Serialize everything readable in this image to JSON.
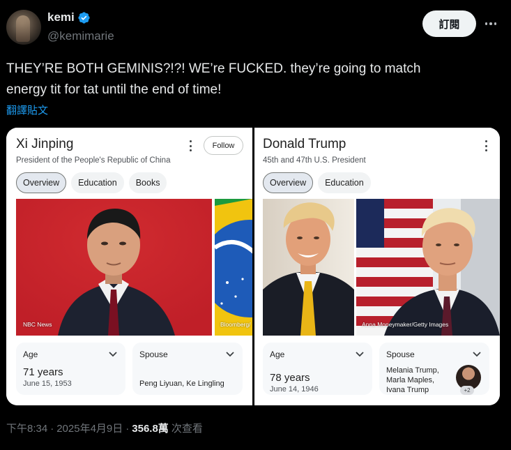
{
  "author": {
    "display_name": "kemi",
    "handle": "@kemimarie"
  },
  "header": {
    "subscribe_label": "訂閱"
  },
  "tweet": {
    "text": "THEY’RE BOTH GEMINIS?!?! WE’re FUCKED. they’re going to match\nenergy tit for tat until the end of time!",
    "translate_label": "翻譯貼文"
  },
  "left_panel": {
    "name": "Xi Jinping",
    "subtitle": "President of the People's Republic of China",
    "follow_label": "Follow",
    "chips": [
      "Overview",
      "Education",
      "Books"
    ],
    "photo_credit_1": "NBC News",
    "photo_credit_2": "Bloomberg/",
    "age_label": "Age",
    "age_value": "71 years",
    "age_date": "June 15, 1953",
    "spouse_label": "Spouse",
    "spouse_value": "Peng Liyuan, Ke Lingling"
  },
  "right_panel": {
    "name": "Donald Trump",
    "subtitle": "45th and 47th U.S. President",
    "chips": [
      "Overview",
      "Education"
    ],
    "photo_credit": "Anna Moneymaker/Getty Images",
    "age_label": "Age",
    "age_value": "78 years",
    "age_date": "June 14, 1946",
    "spouse_label": "Spouse",
    "spouse_lines": [
      "Melania Trump,",
      "Marla Maples,",
      "Ivana Trump"
    ],
    "spouse_more": "+2"
  },
  "meta": {
    "time": "下午8:34",
    "sep1": "·",
    "date": "2025年4月9日",
    "sep2": "·",
    "views_count": "356.8萬",
    "views_label": "次查看"
  },
  "colors": {
    "background": "#000000",
    "link": "#1d9bf0",
    "verified": "#1d9bf0",
    "muted": "#71767b"
  }
}
